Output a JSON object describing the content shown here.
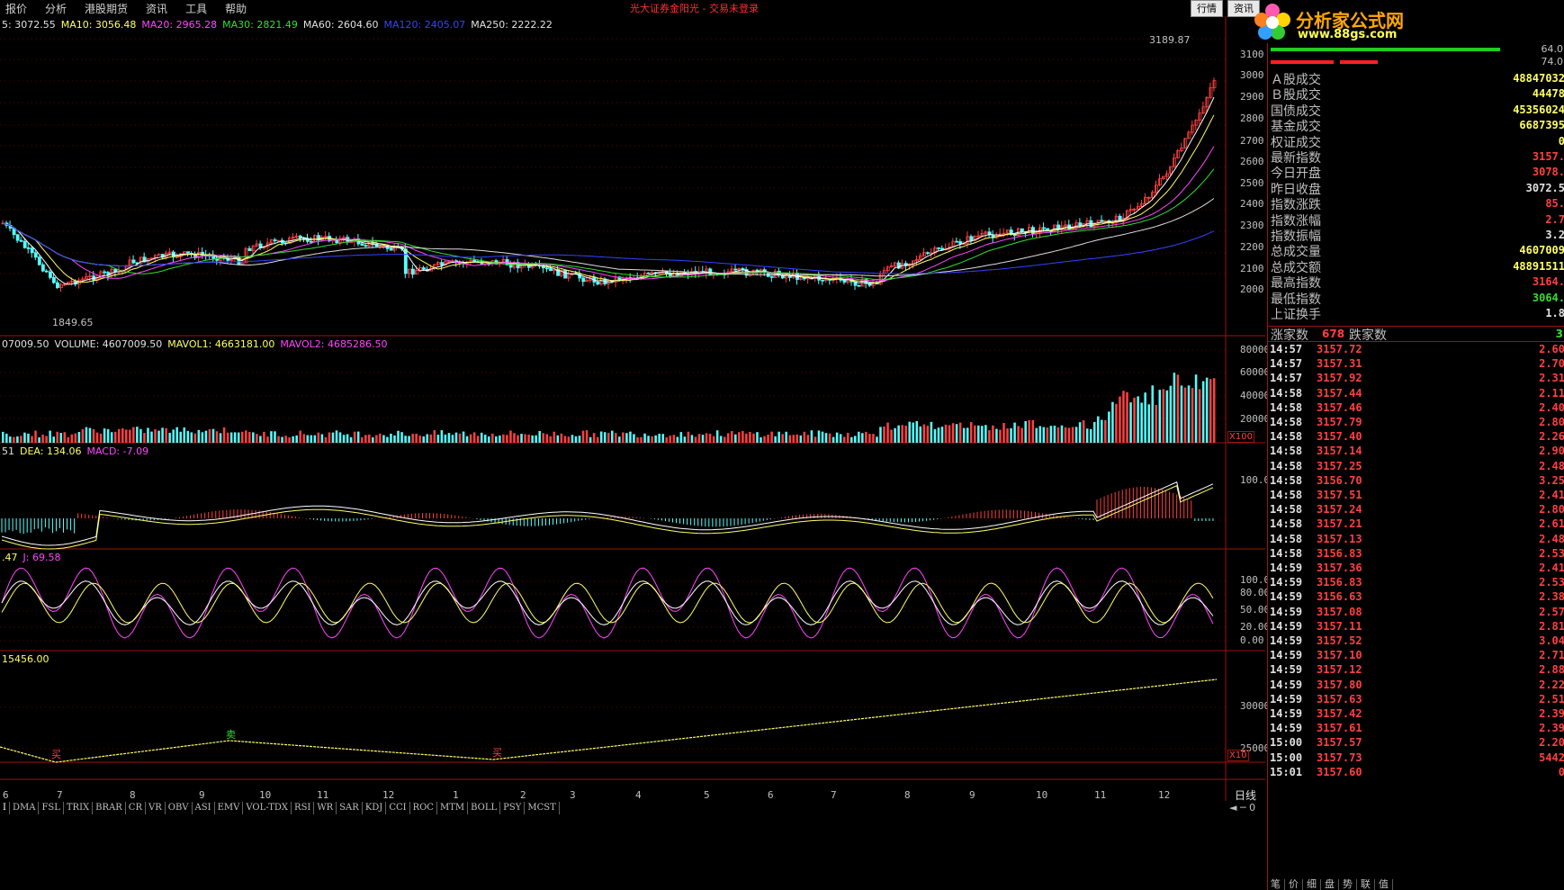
{
  "menu": {
    "items": [
      "报价",
      "分析",
      "港股期货",
      "资讯",
      "工具",
      "帮助"
    ],
    "title": "光大证券金阳光 - 交易未登录",
    "btn_quote": "行情",
    "btn_info": "资讯"
  },
  "logo": {
    "text": "分析家公式网",
    "url": "www.88gs.com"
  },
  "price_panel": {
    "legend": [
      {
        "text": "5: 3072.55",
        "color": "#e0e0e0"
      },
      {
        "text": "MA10: 3056.48",
        "color": "#ffff66"
      },
      {
        "text": "MA20: 2965.28",
        "color": "#ff44ff"
      },
      {
        "text": "MA30: 2821.49",
        "color": "#33dd33"
      },
      {
        "text": "MA60: 2604.60",
        "color": "#e0e0e0"
      },
      {
        "text": "MA120: 2405.07",
        "color": "#3344ff"
      },
      {
        "text": "MA250: 2222.22",
        "color": "#e0e0e0"
      }
    ],
    "high_label": "3189.87",
    "low_label": "1849.65",
    "axis": [
      "3100",
      "3000",
      "2900",
      "2800",
      "2700",
      "2600",
      "2500",
      "2400",
      "2300",
      "2200",
      "2100",
      "2000"
    ]
  },
  "volume_panel": {
    "legend": [
      {
        "text": "07009.50",
        "color": "#e0e0e0"
      },
      {
        "text": "VOLUME: 4607009.50",
        "color": "#e0e0e0"
      },
      {
        "text": "MAVOL1: 4663181.00",
        "color": "#ffff66"
      },
      {
        "text": "MAVOL2: 4685286.50",
        "color": "#ff44ff"
      }
    ],
    "axis": [
      "80000",
      "60000",
      "40000",
      "20000"
    ],
    "unit": "X100"
  },
  "macd_panel": {
    "legend": [
      {
        "text": "51",
        "color": "#e0e0e0"
      },
      {
        "text": "DEA: 134.06",
        "color": "#ffff66"
      },
      {
        "text": "MACD: -7.09",
        "color": "#ff44ff"
      }
    ],
    "axis": [
      "100.0"
    ]
  },
  "kdj_panel": {
    "legend": [
      {
        "text": ".47",
        "color": "#ffff66"
      },
      {
        "text": "J: 69.58",
        "color": "#ff44ff"
      }
    ],
    "axis": [
      "100.00",
      "80.00",
      "50.00",
      "20.00",
      "0.00"
    ]
  },
  "bs_panel": {
    "legend": [
      {
        "text": "15456.00",
        "color": "#ffff66"
      }
    ],
    "axis": [
      "30000",
      "25000"
    ],
    "unit": "X10",
    "buy1": "买",
    "sell": "卖",
    "buy2": "买"
  },
  "time_axis": {
    "labels": [
      "6",
      "7",
      "8",
      "9",
      "10",
      "11",
      "12",
      "1",
      "2",
      "3",
      "4",
      "5",
      "6",
      "7",
      "8",
      "9",
      "10",
      "11",
      "12"
    ],
    "period": "日线"
  },
  "indicator_tabs": [
    "I",
    "DMA",
    "FSL",
    "TRIX",
    "BRAR",
    "CR",
    "VR",
    "OBV",
    "ASI",
    "EMV",
    "VOL-TDX",
    "RSI",
    "WR",
    "SAR",
    "KDJ",
    "CCI",
    "ROC",
    "MTM",
    "BOLL",
    "PSY",
    "MCST"
  ],
  "info": {
    "top_values": [
      "64.0",
      "74.0"
    ],
    "rows": [
      {
        "label": "Ａ股成交",
        "value": "48847032",
        "color": "#ffff66"
      },
      {
        "label": "Ｂ股成交",
        "value": "44478",
        "color": "#ffff66"
      },
      {
        "label": "国债成交",
        "value": "45356024",
        "color": "#ffff66"
      },
      {
        "label": "基金成交",
        "value": "6687395",
        "color": "#ffff66"
      },
      {
        "label": "权证成交",
        "value": "0",
        "color": "#ffff66"
      },
      {
        "label": "最新指数",
        "value": "3157.",
        "color": "#ff4040"
      },
      {
        "label": "今日开盘",
        "value": "3078.",
        "color": "#ff4040"
      },
      {
        "label": "昨日收盘",
        "value": "3072.5",
        "color": "#e0e0e0"
      },
      {
        "label": "指数涨跌",
        "value": "85.",
        "color": "#ff4040"
      },
      {
        "label": "指数涨幅",
        "value": "2.7",
        "color": "#ff4040"
      },
      {
        "label": "指数振幅",
        "value": "3.2",
        "color": "#e0e0e0"
      },
      {
        "label": "总成交量",
        "value": "4607009",
        "color": "#ffff66"
      },
      {
        "label": "总成交额",
        "value": "48891511",
        "color": "#ffff66"
      },
      {
        "label": "最高指数",
        "value": "3164.",
        "color": "#ff4040"
      },
      {
        "label": "最低指数",
        "value": "3064.",
        "color": "#33dd33"
      },
      {
        "label": "上证换手",
        "value": "1.8",
        "color": "#e0e0e0"
      }
    ],
    "up_label": "涨家数",
    "up_value": "678",
    "down_label": "跌家数",
    "down_value": "3",
    "ticks": [
      [
        "14:57",
        "3157.72",
        "2.60"
      ],
      [
        "14:57",
        "3157.31",
        "2.70"
      ],
      [
        "14:57",
        "3157.92",
        "2.31"
      ],
      [
        "14:58",
        "3157.44",
        "2.11"
      ],
      [
        "14:58",
        "3157.46",
        "2.40"
      ],
      [
        "14:58",
        "3157.79",
        "2.80"
      ],
      [
        "14:58",
        "3157.40",
        "2.26"
      ],
      [
        "14:58",
        "3157.14",
        "2.90"
      ],
      [
        "14:58",
        "3157.25",
        "2.48"
      ],
      [
        "14:58",
        "3156.70",
        "3.25"
      ],
      [
        "14:58",
        "3157.51",
        "2.41"
      ],
      [
        "14:58",
        "3157.24",
        "2.80"
      ],
      [
        "14:58",
        "3157.21",
        "2.61"
      ],
      [
        "14:58",
        "3157.13",
        "2.48"
      ],
      [
        "14:58",
        "3156.83",
        "2.53"
      ],
      [
        "14:59",
        "3157.36",
        "2.41"
      ],
      [
        "14:59",
        "3156.83",
        "2.53"
      ],
      [
        "14:59",
        "3156.63",
        "2.38"
      ],
      [
        "14:59",
        "3157.08",
        "2.57"
      ],
      [
        "14:59",
        "3157.11",
        "2.81"
      ],
      [
        "14:59",
        "3157.52",
        "3.04"
      ],
      [
        "14:59",
        "3157.10",
        "2.71"
      ],
      [
        "14:59",
        "3157.12",
        "2.88"
      ],
      [
        "14:59",
        "3157.80",
        "2.22"
      ],
      [
        "14:59",
        "3157.63",
        "2.51"
      ],
      [
        "14:59",
        "3157.42",
        "2.39"
      ],
      [
        "14:59",
        "3157.61",
        "2.39"
      ],
      [
        "15:00",
        "3157.57",
        "2.20"
      ],
      [
        "15:00",
        "3157.73",
        "5442"
      ],
      [
        "15:01",
        "3157.60",
        "0"
      ]
    ],
    "bottom_tabs": [
      "笔",
      "价",
      "细",
      "盘",
      "势",
      "联",
      "值"
    ]
  }
}
